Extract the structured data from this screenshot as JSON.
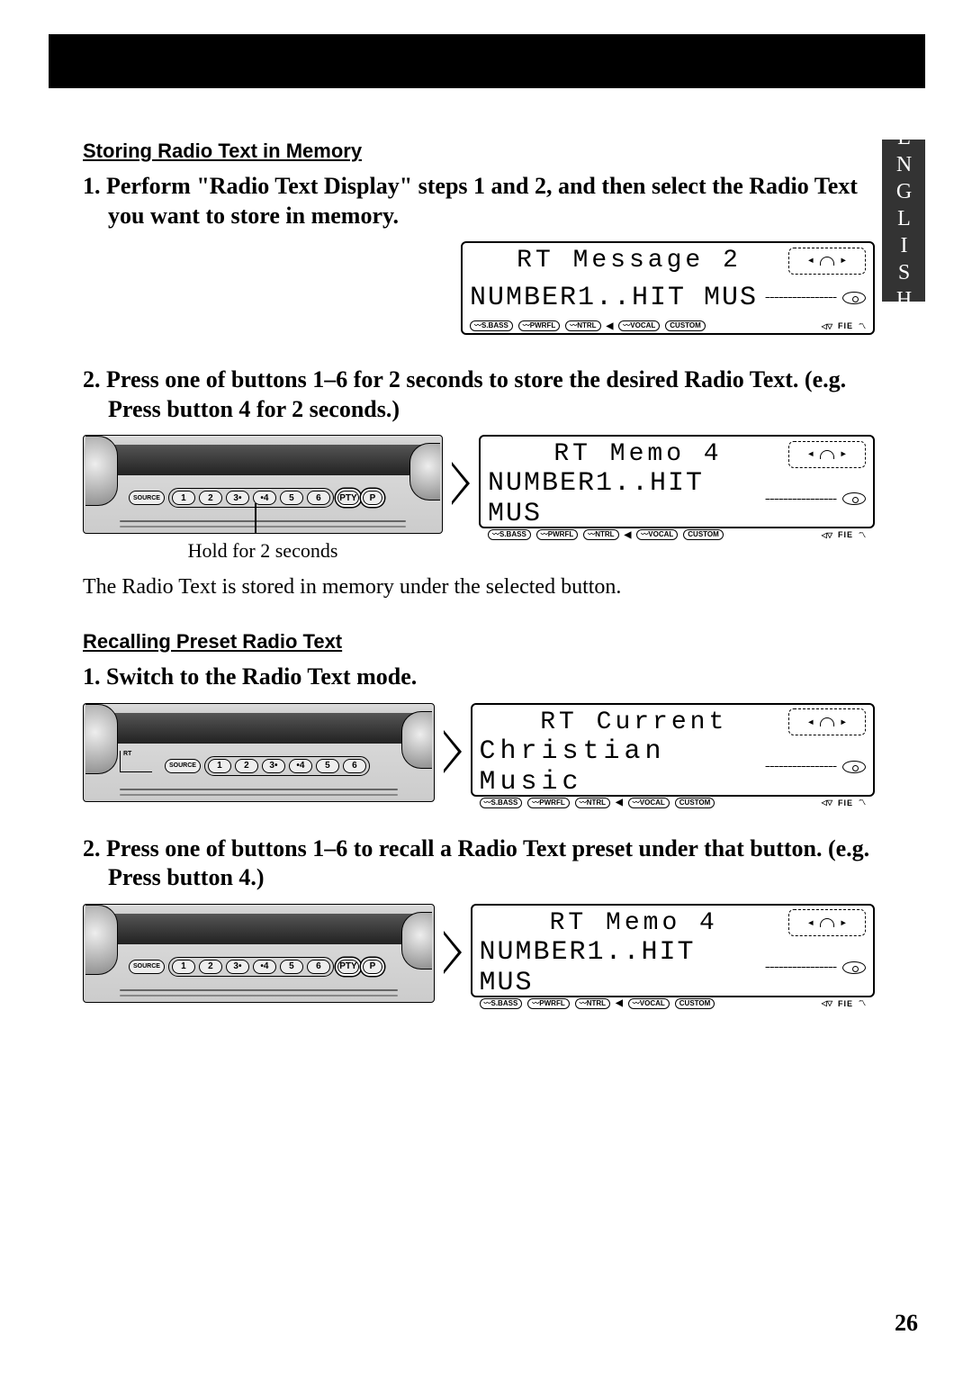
{
  "page_number": "26",
  "side_tab": "ENGLISH",
  "section1": {
    "title": "Storing Radio Text in Memory",
    "step1": "1. Perform \"Radio Text Display\" steps 1 and 2, and then select the Radio Text you want to store in memory.",
    "step2": "2. Press one of buttons 1–6 for 2 seconds to store the desired Radio Text. (e.g. Press button 4 for 2 seconds.)",
    "hold_caption": "Hold for 2 seconds",
    "result": "The Radio Text is stored in memory under the selected button."
  },
  "section2": {
    "title": "Recalling Preset Radio Text",
    "step1": "1. Switch to the Radio Text mode.",
    "step2": "2. Press one of buttons 1–6 to recall a Radio Text preset under that button. (e.g. Press button 4.)"
  },
  "lcd": {
    "msg1_line1": "RT Message 2",
    "msg1_line2": "NUMBER1..HIT MUS",
    "memo_line1": "RT Memo 4",
    "memo_line2": "NUMBER1..HIT MUS",
    "current_line1": "RT Current",
    "current_line2": "Christian Music",
    "indicators": [
      "S.BASS",
      "PWRFL",
      "NTRL",
      "VOCAL",
      "CUSTOM"
    ],
    "fie": "FIE"
  },
  "panel": {
    "source": "SOURCE",
    "buttons": [
      "1",
      "2",
      "3",
      "4",
      "5",
      "6"
    ],
    "pty": "PTY",
    "p": "P",
    "rt": "RT"
  }
}
